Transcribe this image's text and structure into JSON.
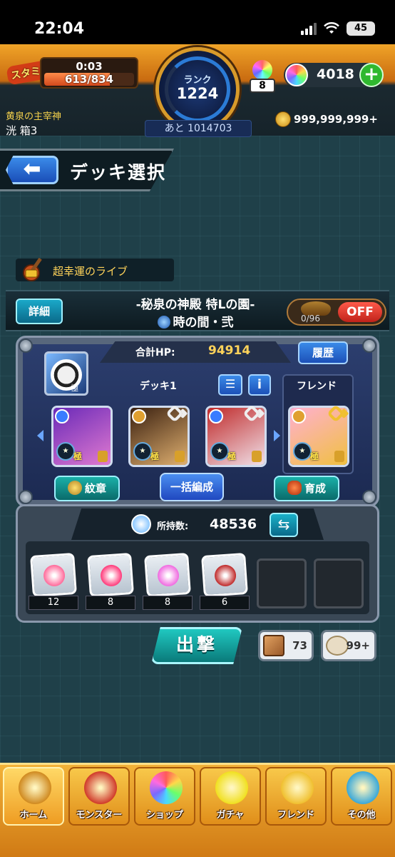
{
  "status_bar": {
    "time": "22:04",
    "battery": "45"
  },
  "header": {
    "stamina_label": "スタミナ",
    "stamina_timer": "0:03",
    "stamina": "613/834",
    "stamina_fraction": 0.73,
    "rank_label": "ランク",
    "rank": "1224",
    "exp_to_next": "あと 1014703",
    "potion_count": "8",
    "orbs": "4018",
    "plus": "+",
    "title": "黄泉の主宰神",
    "player_name": "洸 箱3",
    "gold": "999,999,999+"
  },
  "page": {
    "back": "⬅",
    "title": "デッキ選択"
  },
  "quest": {
    "tag": "超幸運のライブ",
    "detail_button": "詳細",
    "name": "-秘泉の神殿 特Lの園-",
    "stage": "時の間・弐",
    "counter": "0/96",
    "toggle": "OFF"
  },
  "deck": {
    "hp_label": "合計HP:",
    "hp_value": "94914",
    "history_button": "履歴",
    "deck_name": "デッキ1",
    "list_icon": "☰",
    "info_icon": "i",
    "friend_label": "フレンド",
    "monsters": [
      {
        "badge": "極",
        "element_color": "#3a7cff",
        "art_colors": [
          "#6a2ab8",
          "#e07ad0"
        ]
      },
      {
        "badge": "極",
        "element_color": "#e0a030",
        "art_colors": [
          "#3a2010",
          "#e0b070"
        ]
      },
      {
        "badge": "極",
        "element_color": "#3a7cff",
        "art_colors": [
          "#c02a2a",
          "#f0e0e8"
        ]
      }
    ],
    "friend_monster": {
      "badge": "極",
      "element_color": "#e0a030",
      "art_colors": [
        "#ffb0d0",
        "#f0c040"
      ]
    },
    "leader_badge": "極",
    "emblem_button": "紋章",
    "bulk_button": "一括編成",
    "train_button": "育成"
  },
  "items": {
    "own_label": "所持数:",
    "own_value": "48536",
    "swap_icon": "⇆",
    "list": [
      {
        "count": "12",
        "color": "#ff6a9a"
      },
      {
        "count": "8",
        "color": "#ff3a7a"
      },
      {
        "count": "8",
        "color": "#f06ae0"
      },
      {
        "count": "6",
        "color": "#c02a2a"
      }
    ]
  },
  "actions": {
    "sortie": "出撃",
    "chip1_value": "73",
    "chip2_value": "99+"
  },
  "nav": [
    {
      "label": "ホーム",
      "icon": "home-icon",
      "color": "#d08a20"
    },
    {
      "label": "モンスター",
      "icon": "monster-icon",
      "color": "#d03a2a"
    },
    {
      "label": "ショップ",
      "icon": "orb-icon",
      "color": "#7a6aff"
    },
    {
      "label": "ガチャ",
      "icon": "gacha-icon",
      "color": "#f0e020"
    },
    {
      "label": "フレンド",
      "icon": "friend-icon",
      "color": "#f0c030"
    },
    {
      "label": "その他",
      "icon": "other-icon",
      "color": "#3aa8d8"
    }
  ]
}
